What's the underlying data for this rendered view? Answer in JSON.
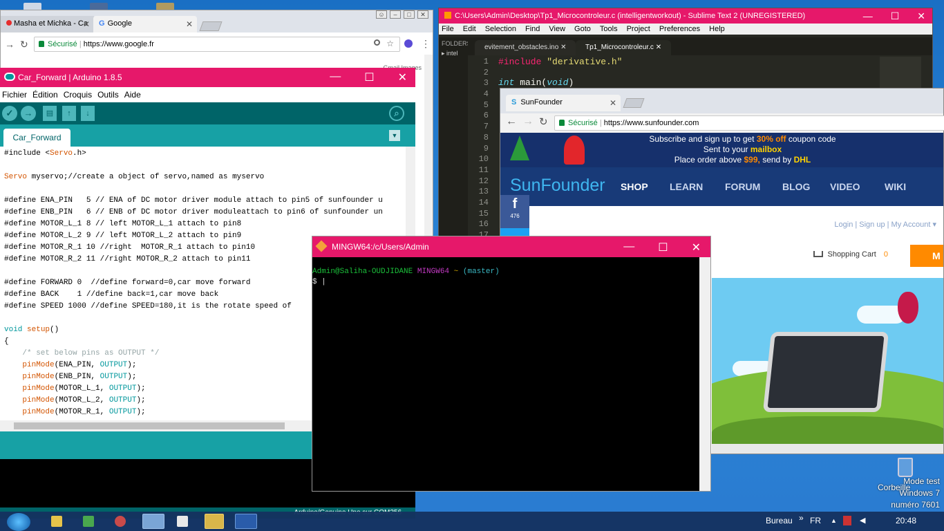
{
  "chrome_back": {
    "tabs": [
      "Masha et Michka - Ca",
      "Google"
    ],
    "secure_label": "Sécurisé",
    "url": "https://www.google.fr",
    "links": "Gmail   Images"
  },
  "sublime": {
    "title": "C:\\Users\\Admin\\Desktop\\Tp1_Microcontroleur.c (intelligentworkout) - Sublime Text 2 (UNREGISTERED)",
    "menu": [
      "File",
      "Edit",
      "Selection",
      "Find",
      "View",
      "Goto",
      "Tools",
      "Project",
      "Preferences",
      "Help"
    ],
    "sidebar_label": "FOLDERS",
    "sidebar_item": "intel",
    "tabs": [
      "evitement_obstacles.ino",
      "Tp1_Microcontroleur.c"
    ],
    "line_numbers": [
      "1",
      "2",
      "3",
      "4",
      "5",
      "6",
      "7",
      "8",
      "9",
      "10",
      "11",
      "12",
      "13",
      "14",
      "15",
      "16",
      "17"
    ],
    "code_line1_kw": "#include",
    "code_line1_str": "\"derivative.h\"",
    "code_line3_kw": "int",
    "code_line3_rest": " main(",
    "code_line3_arg": "void",
    "code_line3_end": ")"
  },
  "chrome_sf": {
    "tab": "SunFounder",
    "secure_label": "Sécurisé",
    "url": "https://www.sunfounder.com",
    "banner_line1_a": "Subscribe and sign up to get ",
    "banner_line1_b": "30% off",
    "banner_line1_c": " coupon code",
    "banner_line2_a": "Sent to your ",
    "banner_line2_b": "mailbox",
    "banner_line3_a": "Place order above ",
    "banner_line3_b": "$99,",
    "banner_line3_c": "   send by ",
    "banner_line3_d": "DHL",
    "logo": "SunFounder",
    "nav": [
      "SHOP",
      "LEARN",
      "FORUM",
      "BLOG",
      "VIDEO",
      "WIKI"
    ],
    "fb_count": "476",
    "account_links": "Login  |  Sign up  |  My Account ▾",
    "cart_label": "Shopping Cart",
    "cart_count": "0",
    "orange_btn": "M"
  },
  "arduino": {
    "title": "Car_Forward | Arduino 1.8.5",
    "menu": [
      "Fichier",
      "Édition",
      "Croquis",
      "Outils",
      "Aide"
    ],
    "tab": "Car_Forward",
    "status": "Arduino/Genuino Uno sur COM256",
    "code": [
      [
        "t",
        "#include <"
      ],
      [
        "ak",
        "Servo"
      ],
      [
        "t",
        ".h>\n\n"
      ],
      [
        "ak",
        "Servo"
      ],
      [
        "t",
        " myservo;//create a object of servo,named as myservo\n\n"
      ],
      [
        "t",
        "#define ENA_PIN   5 // ENA of DC motor driver module attach to pin5 of sunfounder u\n"
      ],
      [
        "t",
        "#define ENB_PIN   6 // ENB of DC motor driver moduleattach to pin6 of sunfounder un\n"
      ],
      [
        "t",
        "#define MOTOR_L_1 8 // left MOTOR_L_1 attach to pin8\n"
      ],
      [
        "t",
        "#define MOTOR_L_2 9 // left MOTOR_L_2 attach to pin9\n"
      ],
      [
        "t",
        "#define MOTOR_R_1 10 //right  MOTOR_R_1 attach to pin10\n"
      ],
      [
        "t",
        "#define MOTOR_R_2 11 //right MOTOR_R_2 attach to pin11\n\n"
      ],
      [
        "t",
        "#define FORWARD 0  //define forward=0,car move forward\n"
      ],
      [
        "t",
        "#define BACK    1 //define back=1,car move back\n"
      ],
      [
        "t",
        "#define SPEED 1000 //define SPEED=180,it is the rotate speed of\n\n"
      ],
      [
        "at",
        "void"
      ],
      [
        "t",
        " "
      ],
      [
        "ak",
        "setup"
      ],
      [
        "t",
        "()\n{\n    "
      ],
      [
        "ac",
        "/* set below pins as OUTPUT */"
      ],
      [
        "t",
        "\n    "
      ],
      [
        "ak",
        "pinMode"
      ],
      [
        "t",
        "(ENA_PIN, "
      ],
      [
        "at",
        "OUTPUT"
      ],
      [
        "t",
        ");\n    "
      ],
      [
        "ak",
        "pinMode"
      ],
      [
        "t",
        "(ENB_PIN, "
      ],
      [
        "at",
        "OUTPUT"
      ],
      [
        "t",
        ");\n    "
      ],
      [
        "ak",
        "pinMode"
      ],
      [
        "t",
        "(MOTOR_L_1, "
      ],
      [
        "at",
        "OUTPUT"
      ],
      [
        "t",
        ");\n    "
      ],
      [
        "ak",
        "pinMode"
      ],
      [
        "t",
        "(MOTOR_L_2, "
      ],
      [
        "at",
        "OUTPUT"
      ],
      [
        "t",
        ");\n    "
      ],
      [
        "ak",
        "pinMode"
      ],
      [
        "t",
        "(MOTOR_R_1, "
      ],
      [
        "at",
        "OUTPUT"
      ],
      [
        "t",
        ");"
      ]
    ]
  },
  "mingw": {
    "title": "MINGW64:/c/Users/Admin",
    "user": "Admin@Saliha-OUDJIDANE",
    "env": "MINGW64",
    "path": "~",
    "branch": "(master)",
    "prompt": "$ |"
  },
  "desktop": {
    "recycle": "Corbeille",
    "watermark": [
      "Mode test",
      "Windows 7",
      "numéro 7601"
    ]
  },
  "taskbar": {
    "desk_label": "Bureau",
    "lang": "FR",
    "time": "20:48",
    "chevron": "»"
  },
  "colors": {
    "title_accent": "#e6186a",
    "arduino_teal": "#006468",
    "sunfounder_navy": "#183a78"
  }
}
